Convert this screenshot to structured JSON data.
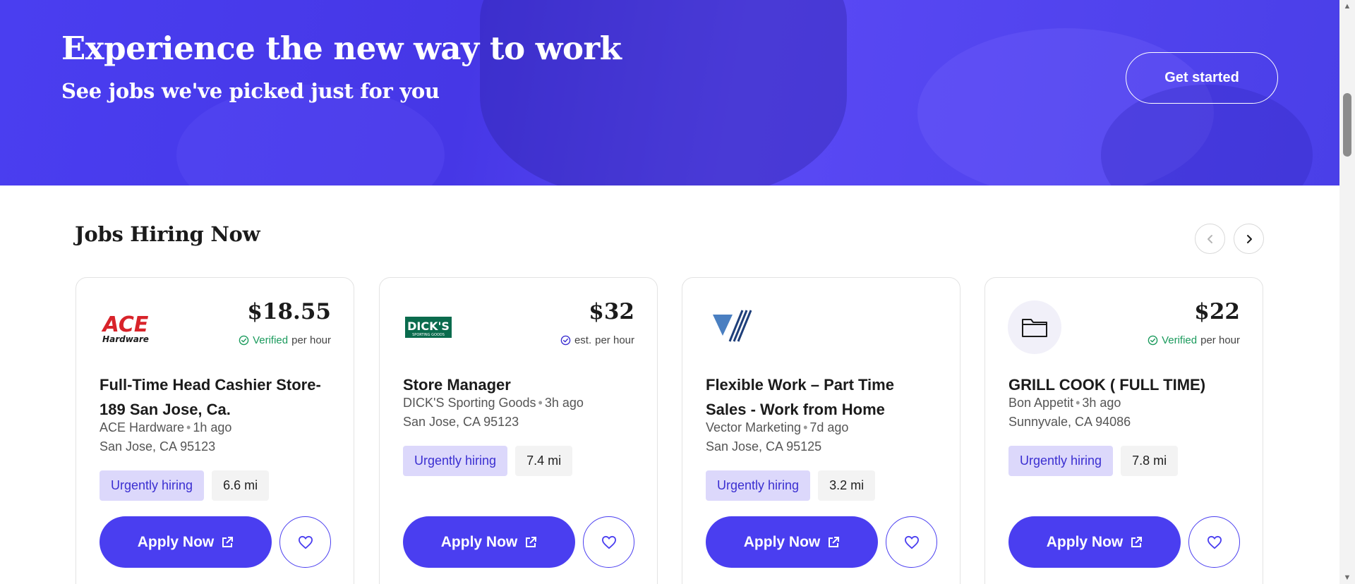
{
  "hero": {
    "title": "Experience the new way to work",
    "subtitle": "See jobs we've picked just for you",
    "cta_label": "Get started"
  },
  "section": {
    "title": "Jobs Hiring Now",
    "prev_icon": "chevron-left-icon",
    "next_icon": "chevron-right-icon"
  },
  "colors": {
    "brand": "#4a3ef0",
    "verified": "#1a9a5c",
    "urgent_bg": "#dcd8fb"
  },
  "jobs": [
    {
      "company_logo": "ACE Hardware logo",
      "pay": "$18.55",
      "pay_status": "Verified",
      "pay_unit": "per hour",
      "title": "Full-Time Head Cashier Store-189 San Jose, Ca.",
      "company": "ACE Hardware",
      "posted": "1h ago",
      "location": "San Jose, CA 95123",
      "tag_urgent": "Urgently hiring",
      "distance": "6.6 mi",
      "apply_label": "Apply Now"
    },
    {
      "company_logo": "DICK'S Sporting Goods logo",
      "pay": "$32",
      "pay_status": "est.",
      "pay_unit": "per hour",
      "title": "Store Manager",
      "company": "DICK'S Sporting Goods",
      "posted": "3h ago",
      "location": "San Jose, CA 95123",
      "tag_urgent": "Urgently hiring",
      "distance": "7.4 mi",
      "apply_label": "Apply Now"
    },
    {
      "company_logo": "Vector Marketing logo",
      "pay": "",
      "pay_status": "",
      "pay_unit": "",
      "title": "Flexible Work – Part Time Sales - Work from Home",
      "company": "Vector Marketing",
      "posted": "7d ago",
      "location": "San Jose, CA 95125",
      "tag_urgent": "Urgently hiring",
      "distance": "3.2 mi",
      "apply_label": "Apply Now"
    },
    {
      "company_logo": "folder-icon",
      "pay": "$22",
      "pay_status": "Verified",
      "pay_unit": "per hour",
      "title": "GRILL COOK ( FULL TIME)",
      "company": "Bon Appetit",
      "posted": "3h ago",
      "location": "Sunnyvale, CA 94086",
      "tag_urgent": "Urgently hiring",
      "distance": "7.8 mi",
      "apply_label": "Apply Now"
    }
  ],
  "logos": {
    "ace_main": "ACE",
    "ace_sub": "Hardware",
    "dicks_main": "DICK'S",
    "dicks_sub": "SPORTING GOODS"
  }
}
